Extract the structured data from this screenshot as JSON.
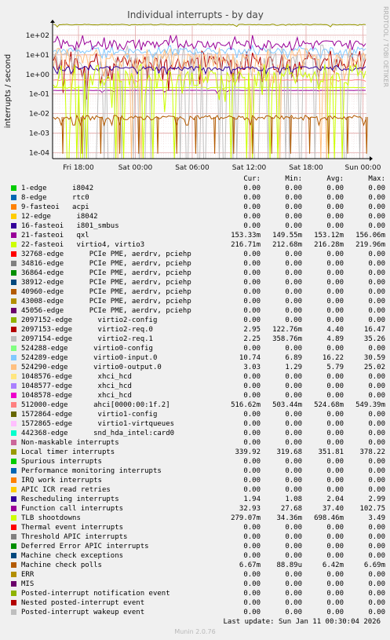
{
  "chart_data": {
    "type": "line",
    "title": "Individual interrupts - by day",
    "ylabel": "interrupts / second",
    "y_scale": "log",
    "ylim": [
      5e-05,
      300
    ],
    "y_ticks": [
      "1e+02",
      "1e+01",
      "1e+00",
      "1e-01",
      "1e-02",
      "1e-03",
      "1e-04"
    ],
    "x_ticks": [
      "Fri 18:00",
      "Sat 00:00",
      "Sat 06:00",
      "Sat 12:00",
      "Sat 18:00",
      "Sun 00:00"
    ],
    "side_text": "RRDTOOL / TOBI OETIKER",
    "columns": [
      "Cur:",
      "Min:",
      "Avg:",
      "Max:"
    ],
    "series": [
      {
        "name": "1-edge      i8042",
        "color": "#00cc00",
        "cur": "0.00",
        "min": "0.00",
        "avg": "0.00",
        "max": "0.00"
      },
      {
        "name": "8-edge      rtc0",
        "color": "#0066b3",
        "cur": "0.00",
        "min": "0.00",
        "avg": "0.00",
        "max": "0.00"
      },
      {
        "name": "9-fasteoi   acpi",
        "color": "#ff8000",
        "cur": "0.00",
        "min": "0.00",
        "avg": "0.00",
        "max": "0.00"
      },
      {
        "name": "12-edge      i8042",
        "color": "#ffcc00",
        "cur": "0.00",
        "min": "0.00",
        "avg": "0.00",
        "max": "0.00"
      },
      {
        "name": "16-fasteoi   i801_smbus",
        "color": "#330099",
        "cur": "0.00",
        "min": "0.00",
        "avg": "0.00",
        "max": "0.00"
      },
      {
        "name": "21-fasteoi   qxl",
        "color": "#990099",
        "cur": "153.33m",
        "min": "149.55m",
        "avg": "153.12m",
        "max": "156.06m"
      },
      {
        "name": "22-fasteoi   virtio4, virtio3",
        "color": "#ccff00",
        "cur": "216.71m",
        "min": "212.68m",
        "avg": "216.28m",
        "max": "219.96m"
      },
      {
        "name": "32768-edge      PCIe PME, aerdrv, pciehp",
        "color": "#ff0000",
        "cur": "0.00",
        "min": "0.00",
        "avg": "0.00",
        "max": "0.00"
      },
      {
        "name": "34816-edge      PCIe PME, aerdrv, pciehp",
        "color": "#808080",
        "cur": "0.00",
        "min": "0.00",
        "avg": "0.00",
        "max": "0.00"
      },
      {
        "name": "36864-edge      PCIe PME, aerdrv, pciehp",
        "color": "#008f00",
        "cur": "0.00",
        "min": "0.00",
        "avg": "0.00",
        "max": "0.00"
      },
      {
        "name": "38912-edge      PCIe PME, aerdrv, pciehp",
        "color": "#00487d",
        "cur": "0.00",
        "min": "0.00",
        "avg": "0.00",
        "max": "0.00"
      },
      {
        "name": "40960-edge      PCIe PME, aerdrv, pciehp",
        "color": "#b35a00",
        "cur": "0.00",
        "min": "0.00",
        "avg": "0.00",
        "max": "0.00"
      },
      {
        "name": "43008-edge      PCIe PME, aerdrv, pciehp",
        "color": "#b38f00",
        "cur": "0.00",
        "min": "0.00",
        "avg": "0.00",
        "max": "0.00"
      },
      {
        "name": "45056-edge      PCIe PME, aerdrv, pciehp",
        "color": "#6b006b",
        "cur": "0.00",
        "min": "0.00",
        "avg": "0.00",
        "max": "0.00"
      },
      {
        "name": "2097152-edge      virtio2-config",
        "color": "#8fb300",
        "cur": "0.00",
        "min": "0.00",
        "avg": "0.00",
        "max": "0.00"
      },
      {
        "name": "2097153-edge      virtio2-req.0",
        "color": "#b30000",
        "cur": "2.95",
        "min": "122.76m",
        "avg": "4.40",
        "max": "16.47"
      },
      {
        "name": "2097154-edge      virtio2-req.1",
        "color": "#bebebe",
        "cur": "2.25",
        "min": "358.76m",
        "avg": "4.89",
        "max": "35.26"
      },
      {
        "name": "524288-edge      virtio0-config",
        "color": "#80ff80",
        "cur": "0.00",
        "min": "0.00",
        "avg": "0.00",
        "max": "0.00"
      },
      {
        "name": "524289-edge      virtio0-input.0",
        "color": "#80c9ff",
        "cur": "10.74",
        "min": "6.89",
        "avg": "16.22",
        "max": "30.59"
      },
      {
        "name": "524290-edge      virtio0-output.0",
        "color": "#ffc080",
        "cur": "3.03",
        "min": "1.29",
        "avg": "5.79",
        "max": "25.02"
      },
      {
        "name": "1048576-edge      xhci_hcd",
        "color": "#ffe680",
        "cur": "0.00",
        "min": "0.00",
        "avg": "0.00",
        "max": "0.00"
      },
      {
        "name": "1048577-edge      xhci_hcd",
        "color": "#aa80ff",
        "cur": "0.00",
        "min": "0.00",
        "avg": "0.00",
        "max": "0.00"
      },
      {
        "name": "1048578-edge      xhci_hcd",
        "color": "#ee00cc",
        "cur": "0.00",
        "min": "0.00",
        "avg": "0.00",
        "max": "0.00"
      },
      {
        "name": "512000-edge      ahci[0000:00:1f.2]",
        "color": "#ff8080",
        "cur": "516.62m",
        "min": "503.44m",
        "avg": "524.68m",
        "max": "549.39m"
      },
      {
        "name": "1572864-edge      virtio1-config",
        "color": "#666600",
        "cur": "0.00",
        "min": "0.00",
        "avg": "0.00",
        "max": "0.00"
      },
      {
        "name": "1572865-edge      virtio1-virtqueues",
        "color": "#ffbfff",
        "cur": "0.00",
        "min": "0.00",
        "avg": "0.00",
        "max": "0.00"
      },
      {
        "name": "442368-edge      snd_hda_intel:card0",
        "color": "#00ffcc",
        "cur": "0.00",
        "min": "0.00",
        "avg": "0.00",
        "max": "0.00"
      },
      {
        "name": "Non-maskable interrupts",
        "color": "#cc6699",
        "cur": "0.00",
        "min": "0.00",
        "avg": "0.00",
        "max": "0.00"
      },
      {
        "name": "Local timer interrupts",
        "color": "#999900",
        "cur": "339.92",
        "min": "319.68",
        "avg": "351.81",
        "max": "378.22"
      },
      {
        "name": "Spurious interrupts",
        "color": "#00cc00",
        "cur": "0.00",
        "min": "0.00",
        "avg": "0.00",
        "max": "0.00"
      },
      {
        "name": "Performance monitoring interrupts",
        "color": "#0066b3",
        "cur": "0.00",
        "min": "0.00",
        "avg": "0.00",
        "max": "0.00"
      },
      {
        "name": "IRQ work interrupts",
        "color": "#ff8000",
        "cur": "0.00",
        "min": "0.00",
        "avg": "0.00",
        "max": "0.00"
      },
      {
        "name": "APIC ICR read retries",
        "color": "#ffcc00",
        "cur": "0.00",
        "min": "0.00",
        "avg": "0.00",
        "max": "0.00"
      },
      {
        "name": "Rescheduling interrupts",
        "color": "#330099",
        "cur": "1.94",
        "min": "1.08",
        "avg": "2.04",
        "max": "2.99"
      },
      {
        "name": "Function call interrupts",
        "color": "#990099",
        "cur": "32.93",
        "min": "27.68",
        "avg": "37.40",
        "max": "102.75"
      },
      {
        "name": "TLB shootdowns",
        "color": "#ccff00",
        "cur": "279.07m",
        "min": "34.36m",
        "avg": "698.46m",
        "max": "3.49"
      },
      {
        "name": "Thermal event interrupts",
        "color": "#ff0000",
        "cur": "0.00",
        "min": "0.00",
        "avg": "0.00",
        "max": "0.00"
      },
      {
        "name": "Threshold APIC interrupts",
        "color": "#808080",
        "cur": "0.00",
        "min": "0.00",
        "avg": "0.00",
        "max": "0.00"
      },
      {
        "name": "Deferred Error APIC interrupts",
        "color": "#008f00",
        "cur": "0.00",
        "min": "0.00",
        "avg": "0.00",
        "max": "0.00"
      },
      {
        "name": "Machine check exceptions",
        "color": "#00487d",
        "cur": "0.00",
        "min": "0.00",
        "avg": "0.00",
        "max": "0.00"
      },
      {
        "name": "Machine check polls",
        "color": "#b35a00",
        "cur": "6.67m",
        "min": "88.89u",
        "avg": "6.42m",
        "max": "6.69m"
      },
      {
        "name": "ERR",
        "color": "#b38f00",
        "cur": "0.00",
        "min": "0.00",
        "avg": "0.00",
        "max": "0.00"
      },
      {
        "name": "MIS",
        "color": "#6b006b",
        "cur": "0.00",
        "min": "0.00",
        "avg": "0.00",
        "max": "0.00"
      },
      {
        "name": "Posted-interrupt notification event",
        "color": "#8fb300",
        "cur": "0.00",
        "min": "0.00",
        "avg": "0.00",
        "max": "0.00"
      },
      {
        "name": "Nested posted-interrupt event",
        "color": "#b30000",
        "cur": "0.00",
        "min": "0.00",
        "avg": "0.00",
        "max": "0.00"
      },
      {
        "name": "Posted-interrupt wakeup event",
        "color": "#bebebe",
        "cur": "0.00",
        "min": "0.00",
        "avg": "0.00",
        "max": "0.00"
      }
    ],
    "last_update": "Last update: Sun Jan 11 00:30:04 2026",
    "footer": "Munin 2.0.76"
  }
}
